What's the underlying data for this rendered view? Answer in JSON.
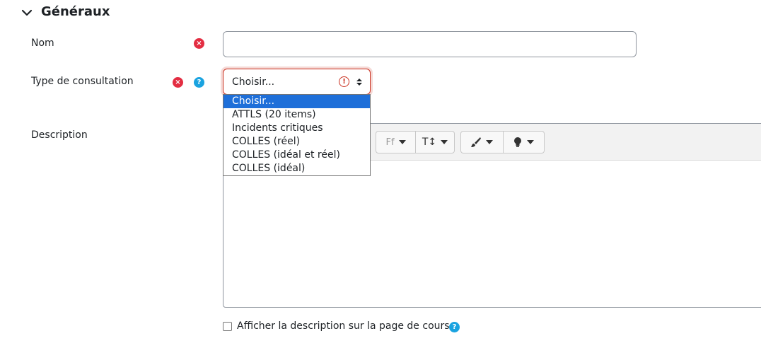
{
  "section": {
    "title": "Généraux"
  },
  "fields": {
    "nom": {
      "label": "Nom",
      "value": ""
    },
    "type": {
      "label": "Type de consultation",
      "selected": "Choisir...",
      "options": [
        "Choisir...",
        "ATTLS (20 items)",
        "Incidents critiques",
        "COLLES (réel)",
        "COLLES (idéal et réel)",
        "COLLES (idéal)"
      ]
    },
    "description": {
      "label": "Description"
    }
  },
  "editor_toolbar": {
    "font_family_icon": "Ff",
    "font_size_icon": "T↕"
  },
  "checkbox": {
    "label": "Afficher la description sur la page de cours",
    "checked": false
  },
  "icons": {
    "required": "×",
    "help": "?",
    "warning": "!"
  },
  "colors": {
    "required": "#e32d42",
    "help": "#1aa3e0",
    "selected_option": "#1e6fd9",
    "invalid_border": "#ca3120"
  }
}
